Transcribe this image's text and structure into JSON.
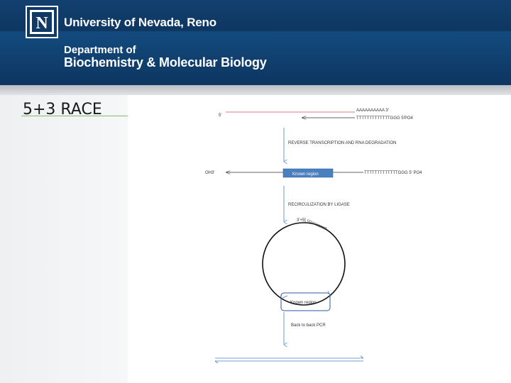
{
  "header": {
    "logo_letter": "N",
    "university": "University of Nevada, Reno",
    "department_line1": "Department of",
    "department_line2": "Biochemistry & Molecular Biology"
  },
  "slide": {
    "title": "5+3 RACE"
  },
  "diagram": {
    "mrna_5prime": "5'",
    "mrna_polya": "AAAAAAAAAA  3'",
    "primer": "TTTTTTTTTTTTTGGG 5'PO4",
    "step1": "REVERSE TRANSCRIPTION AND RNA DEGRADATION",
    "oh3": "OH3'",
    "known_region": "Known region",
    "cdna_primer": "TTTTTTTTTTTTTGGG 5' PO4",
    "step2": "RECIRCULIZATION BY LIGASE",
    "junction": "3'+5[",
    "ligation_tail": "ccuuaaaad",
    "known_region_circle": "Known region",
    "step3": "Back to back PCR"
  }
}
